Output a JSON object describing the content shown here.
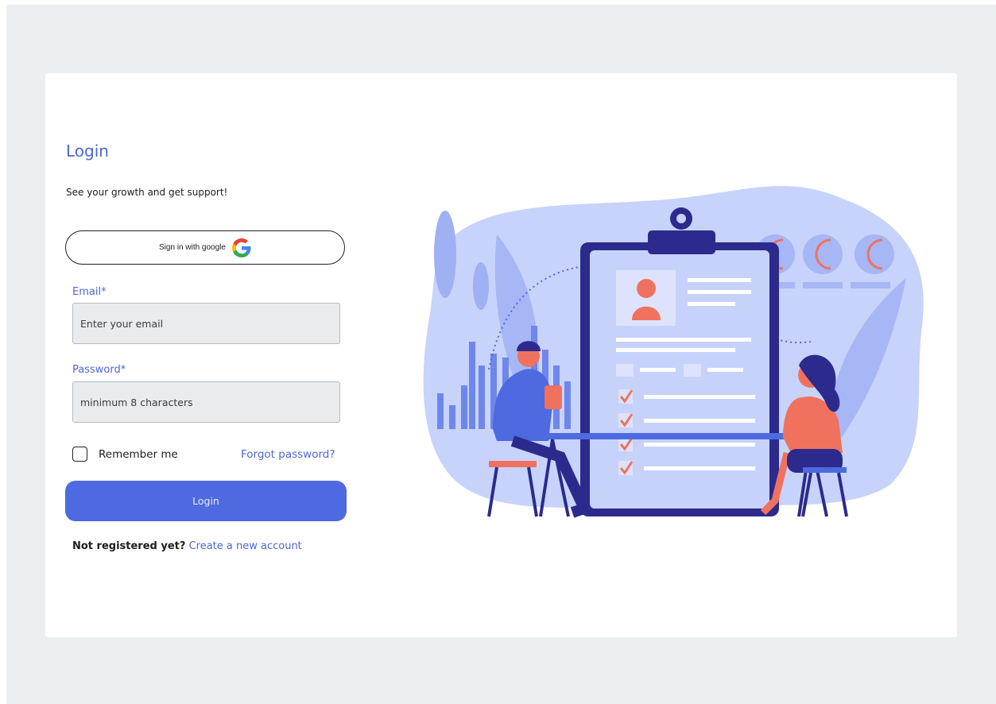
{
  "login": {
    "title": "Login",
    "subtitle": "See your growth and get support!",
    "google_button_label": "Sign in with google",
    "email_label": "Email*",
    "email_placeholder": "Enter your email",
    "password_label": "Password*",
    "password_placeholder": "minimum 8 characters",
    "remember_label": "Remember me",
    "forgot_label": "Forgot password?",
    "submit_label": "Login",
    "signup_question": "Not registered yet?",
    "signup_link": "Create a new account"
  },
  "colors": {
    "accent": "#4d67d8",
    "button": "#4d6ae0",
    "page_background": "#eceff2",
    "input_background": "#e9ebed",
    "illustration_coral": "#f0725e",
    "illustration_navy": "#2c2a8c"
  },
  "icons": {
    "google": "google-g-icon",
    "checkbox": "checkbox-unchecked-icon"
  }
}
